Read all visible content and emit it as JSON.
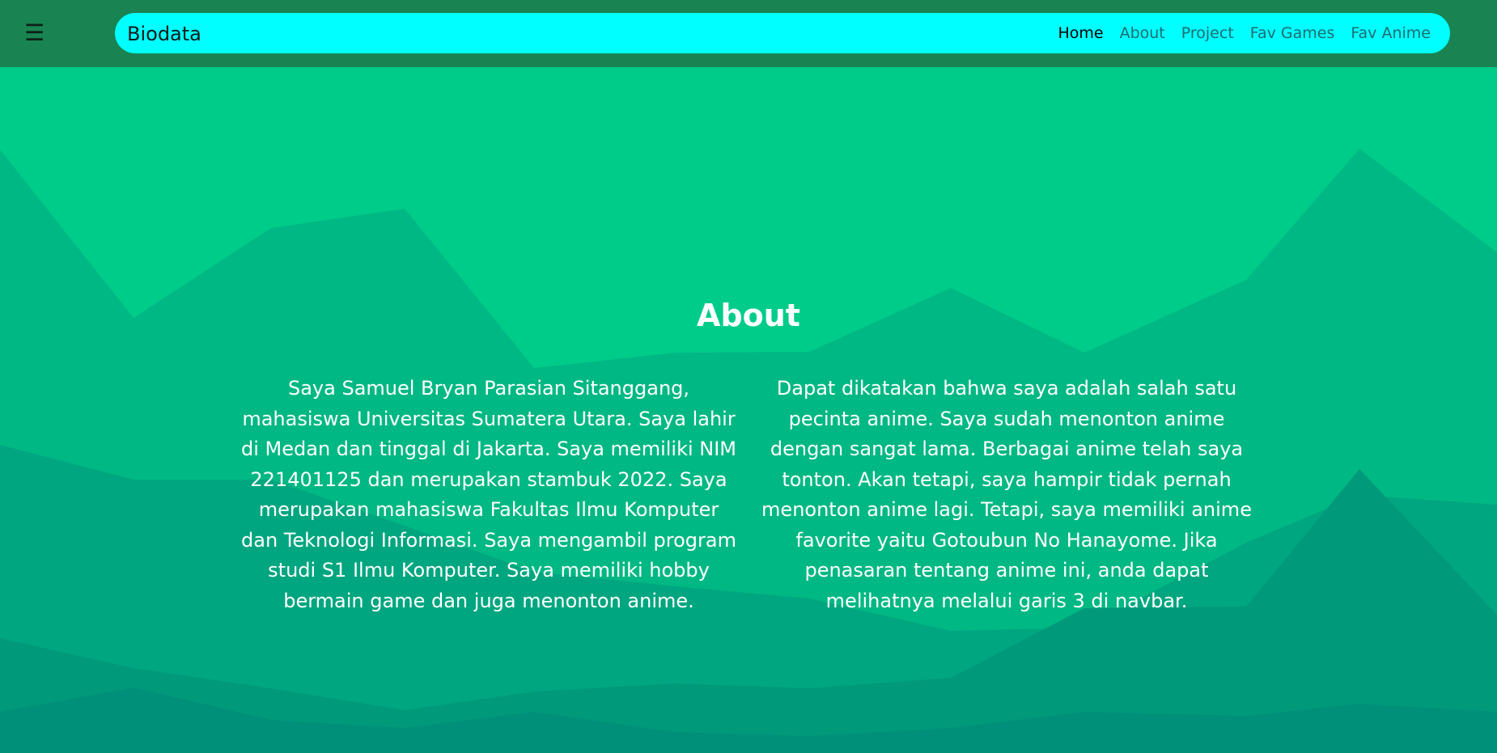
{
  "navbar": {
    "menu_icon": "hamburger-icon",
    "menu_glyph": "☰",
    "brand": "Biodata",
    "links": [
      {
        "label": "Home",
        "active": true
      },
      {
        "label": "About",
        "active": false
      },
      {
        "label": "Project",
        "active": false
      },
      {
        "label": "Fav Games",
        "active": false
      },
      {
        "label": "Fav Anime",
        "active": false
      }
    ]
  },
  "about": {
    "title": "About",
    "left_paragraph": "Saya Samuel Bryan Parasian Sitanggang, mahasiswa Universitas Sumatera Utara. Saya lahir di Medan dan tinggal di Jakarta. Saya memiliki NIM 221401125 dan merupakan stambuk 2022. Saya merupakan mahasiswa Fakultas Ilmu Komputer dan Teknologi Informasi. Saya mengambil program studi S1 Ilmu Komputer. Saya memiliki hobby bermain game dan juga menonton anime.",
    "right_paragraph": "Dapat dikatakan bahwa saya adalah salah satu pecinta anime. Saya sudah menonton anime dengan sangat lama. Berbagai anime telah saya tonton. Akan tetapi, saya hampir tidak pernah menonton anime lagi. Tetapi, saya memiliki anime favorite yaitu Gotoubun No Hanayome. Jika penasaran tentang anime ini, anda dapat melihatnya melalui garis 3 di navbar."
  },
  "colors": {
    "topbar": "#1a8352",
    "navbar": "#00ffff",
    "background": "#00cc8a",
    "text": "#ffffff"
  }
}
